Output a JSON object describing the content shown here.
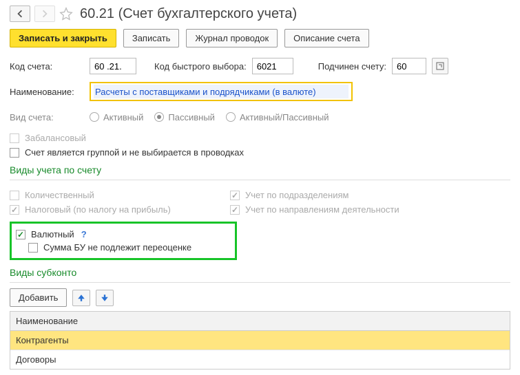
{
  "header": {
    "title": "60.21 (Счет бухгалтерского учета)"
  },
  "toolbar": {
    "save_close": "Записать и закрыть",
    "save": "Записать",
    "journal": "Журнал проводок",
    "description": "Описание счета"
  },
  "fields": {
    "code_label": "Код счета:",
    "code_value": "60 .21.",
    "quick_label": "Код быстрого выбора:",
    "quick_value": "6021",
    "parent_label": "Подчинен счету:",
    "parent_value": "60",
    "name_label": "Наименование:",
    "name_value": "Расчеты с поставщиками и подрядчиками (в валюте)",
    "kind_label": "Вид счета:",
    "kind_options": {
      "active": "Активный",
      "passive": "Пассивный",
      "active_passive": "Активный/Пассивный"
    },
    "offbalance": "Забалансовый",
    "group_flag": "Счет является группой и не выбирается в проводках"
  },
  "accounting_types": {
    "title": "Виды учета по счету",
    "qty": "Количественный",
    "tax": "Налоговый (по налогу на прибыль)",
    "dept": "Учет по подразделениям",
    "direction": "Учет по направлениям деятельности",
    "currency": "Валютный",
    "help": "?",
    "no_reval": "Сумма БУ не подлежит переоценке"
  },
  "subconto": {
    "title": "Виды субконто",
    "add": "Добавить",
    "header": "Наименование",
    "rows": [
      "Контрагенты",
      "Договоры"
    ]
  }
}
